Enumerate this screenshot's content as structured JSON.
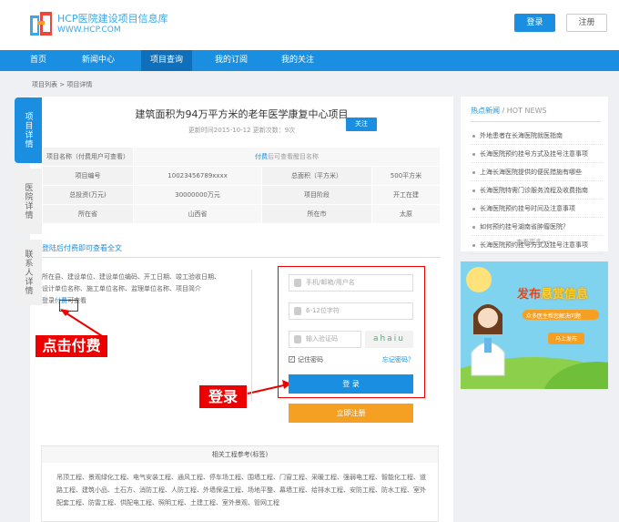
{
  "brand": {
    "name": "HCP医院建设项目信息库",
    "url": "WWW.HCP.COM",
    "logo_text": "HCP"
  },
  "header": {
    "login": "登录",
    "register": "注册"
  },
  "nav": [
    "首页",
    "新闻中心",
    "项目查询",
    "我的订阅",
    "我的关注"
  ],
  "breadcrumb": "项目列表 > 项目详情",
  "side_tabs": [
    "项目详情",
    "医院详情",
    "联系人详情"
  ],
  "project": {
    "title": "建筑面积为94万平方米的老年医学康复中心项目",
    "update": "更新时间2015-10-12    更新次数：9次",
    "follow": "关注",
    "name_label": "项目名称（付费用户可查看）",
    "name_value": "付费后可查看醒目名称",
    "rows": [
      [
        "项目编号",
        "10023456789xxxx",
        "总面积（平方米）",
        "500平方米"
      ],
      [
        "总投资(万元)",
        "30000000万元",
        "项目阶段",
        "开工在建"
      ],
      [
        "所在省",
        "山西省",
        "所在市",
        "太原"
      ]
    ]
  },
  "view_all": "登陆后付费即可查看全文",
  "fields_text": [
    "所在县、建设单位、建设单位编码、开工日期、竣工验收日期、",
    "设计单位名称、施工单位名称、监理单位名称、项目简介"
  ],
  "pay_line": {
    "pre": "登录",
    "link": "付费",
    "post": "可查看"
  },
  "annotations": {
    "pay": "点击付费",
    "login": "登录"
  },
  "login_form": {
    "user_placeholder": "手机/邮箱/用户名",
    "pwd_placeholder": "6-12位字符",
    "code_placeholder": "输入验证码",
    "captcha": "ahaiu",
    "remember": "记住密码",
    "forgot": "忘记密码？",
    "login_btn": "登  录",
    "register_btn": "立即注册"
  },
  "related": {
    "title": "相关工程参考(标签)",
    "text": "吊顶工程、景观绿化工程、电气安装工程、通风工程、停车场工程、围墙工程、门窗工程、采暖工程、强弱电工程、智能化工程、道路工程、建筑小品、土石方、消防工程、人防工程、外墙保温工程、场地平整、幕墙工程、给排水工程、安防工程、防水工程、室外配套工程、防雷工程、供配电工程、照明工程、土建工程、室外景观、管网工程"
  },
  "news": {
    "title_cn": "热点新闻",
    "title_en": "/ HOT NEWS",
    "items": [
      "外地患者在长海医院就医指南",
      "长海医院预约挂号方式及挂号注意事项",
      "上海长海医院提供的便民措施有哪些",
      "长海医院特需门诊服务流程及收费指南",
      "长海医院预约挂号时间及注意事项",
      "如何预约挂号湖南省肿瘤医院？",
      "长海医院预约挂号方式及挂号注意事项"
    ],
    "more": "查看更多>>"
  },
  "ad": {
    "title_a": "发布",
    "title_b": "悬赏信息",
    "sub": "众多医生帮您解决问题",
    "btn": "马上发布"
  },
  "colors": {
    "primary": "#1a8fe1",
    "accent": "#f5a023",
    "highlight": "#e00000"
  }
}
